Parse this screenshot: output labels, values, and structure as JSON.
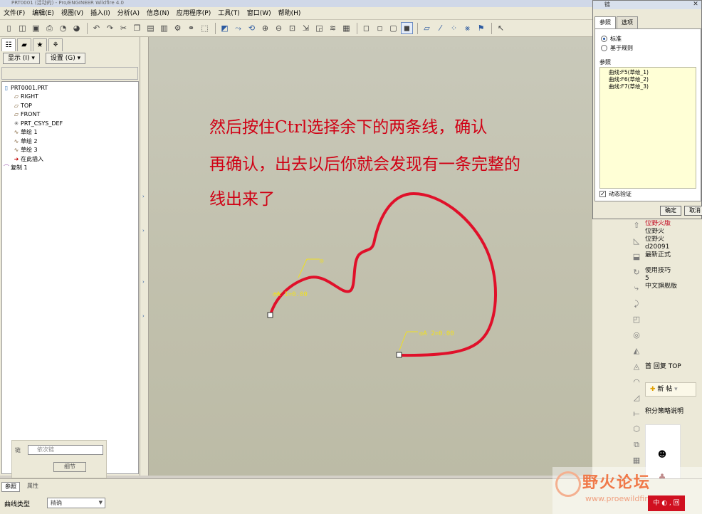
{
  "window": {
    "title": "PRT0001 (活动的) - Pro/ENGINEER Wildfire 4.0"
  },
  "menu": [
    "文件(F)",
    "编辑(E)",
    "视图(V)",
    "插入(I)",
    "分析(A)",
    "信息(N)",
    "应用程序(P)",
    "工具(T)",
    "窗口(W)",
    "帮助(H)"
  ],
  "toolbar": {
    "icons": [
      "new-icon",
      "open-icon",
      "save-icon",
      "print-icon",
      "email-icon",
      "email-attach-icon",
      "undo-icon",
      "redo-icon",
      "cut-icon",
      "copy-icon",
      "paste-icon",
      "paste-special-icon",
      "regenerate-icon",
      "find-icon",
      "select-box-icon",
      "repaint-icon",
      "spin-center-icon",
      "orient-icon",
      "zoom-in-icon",
      "zoom-out-icon",
      "refit-icon",
      "reorient-icon",
      "saved-views-icon",
      "layers-icon",
      "view-manager-icon",
      "wireframe-icon",
      "hidden-line-icon",
      "no-hidden-icon",
      "shaded-icon",
      "datum-planes-icon",
      "datum-axes-icon",
      "datum-points-icon",
      "csys-icon",
      "annotations-icon",
      "context-help-icon"
    ]
  },
  "left_panel": {
    "display_label": "显示 (I) ▾",
    "settings_label": "设置 (G) ▾",
    "tree": [
      {
        "icon": "part",
        "label": "PRT0001.PRT",
        "indent": 0
      },
      {
        "icon": "plane",
        "label": "RIGHT",
        "indent": 1
      },
      {
        "icon": "plane",
        "label": "TOP",
        "indent": 1
      },
      {
        "icon": "plane",
        "label": "FRONT",
        "indent": 1
      },
      {
        "icon": "csys",
        "label": "PRT_CSYS_DEF",
        "indent": 1
      },
      {
        "icon": "sketch",
        "label": "草绘 1",
        "indent": 1
      },
      {
        "icon": "sketch",
        "label": "草绘 2",
        "indent": 1
      },
      {
        "icon": "sketch",
        "label": "草绘 3",
        "indent": 1
      },
      {
        "icon": "insert",
        "label": "在此插入",
        "indent": 1
      },
      {
        "icon": "copy",
        "label": "复制 1",
        "indent": 0
      }
    ]
  },
  "annotation": {
    "line1": "然后按住Ctrl选择余下的两条线，确认",
    "line2": "再确认，出去以后你就会发现有一条完整的",
    "line3": "线出来了",
    "color": "#d00014"
  },
  "curve_labels": {
    "top": "◎",
    "start": "◎A 1=0.00",
    "end": "◎A 2=0.00"
  },
  "dialog": {
    "title": "链",
    "tabs": [
      "参照",
      "选项"
    ],
    "radio_standard": "标准",
    "radio_rule": "基于规则",
    "ref_label": "参照",
    "refs": [
      "曲线:F5(草绘_1)",
      "曲线:F6(草绘_2)",
      "曲线:F7(草绘_3)"
    ],
    "dynamic_check": "动态验证",
    "ok": "确定",
    "cancel": "取消"
  },
  "forum": {
    "lines": [
      "位野火版",
      "位野火",
      "位野火",
      "d20091",
      "最新正式",
      "",
      "使用技巧",
      "5",
      "中文旗舰版"
    ],
    "nav": "首 回复 TOP",
    "new_post": "新 帖",
    "jifen": "积分策略说明"
  },
  "bottom": {
    "chain_label": "链",
    "chain_placeholder": "依次链",
    "detail_btn": "细节",
    "tab_ref": "参照",
    "tab_props": "属性",
    "curve_type_label": "曲线类型",
    "curve_type_value": "精确"
  },
  "watermark": {
    "text": "野火论坛",
    "url": "www.proewildfire.cn"
  },
  "ime": {
    "label": "中 ◐ , 回"
  }
}
